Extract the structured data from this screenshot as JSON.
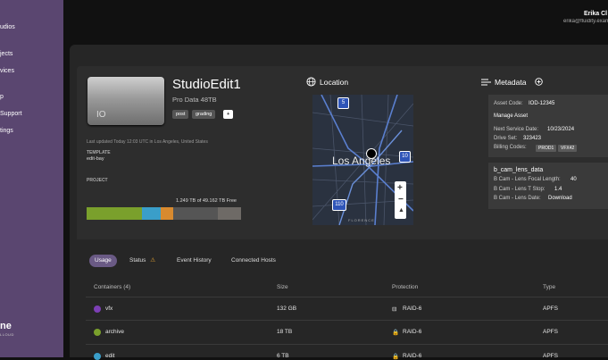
{
  "sidebar": {
    "items": [
      {
        "label": "udios"
      },
      {
        "label": "jects"
      },
      {
        "label": "vices"
      },
      {
        "label": "p"
      },
      {
        "label": "Support"
      },
      {
        "label": "tings"
      }
    ],
    "brand": {
      "name": "ne",
      "sub": "LLOUD"
    }
  },
  "user": {
    "name": "Erika Cl",
    "email": "erika@fluidity.examp"
  },
  "asset": {
    "title": "StudioEdit1",
    "subtitle": "Pro Data 48TB",
    "device_mark": "IO",
    "tags": [
      "post",
      "grading",
      "+"
    ],
    "last_updated": "Last updated Today 12:03 UTC in Los Angeles, United States",
    "template_label": "TEMPLATE",
    "template_value": "edit-bay",
    "project_label": "PROJECT",
    "usage_text": "1.249 TB of 49.162 TB Free",
    "usage_segments": [
      {
        "fraction": 0.36,
        "color": "#7aa02c"
      },
      {
        "fraction": 0.12,
        "color": "#3a9ec9"
      },
      {
        "fraction": 0.08,
        "color": "#d88a2f"
      },
      {
        "fraction": 0.29,
        "color": "#555555"
      },
      {
        "fraction": 0.15,
        "color": "#6e6a66"
      }
    ]
  },
  "location": {
    "title": "Location",
    "city": "Los Angeles",
    "highways": [
      "5",
      "10",
      "110"
    ],
    "map_footer": "FLORENCE"
  },
  "metadata": {
    "title": "Metadata",
    "card1": {
      "asset_code_label": "Asset Code:",
      "asset_code": "IOD-12345",
      "section": "Manage Asset",
      "next_service_label": "Next Service Date:",
      "next_service": "10/23/2024",
      "drive_set_label": "Drive Set:",
      "drive_set": "323423",
      "billing_label": "Billing Codes:",
      "billing_codes": [
        "PROD1",
        "VFX42"
      ]
    },
    "card2": {
      "title": "b_cam_lens_data",
      "focal_label": "B Cam - Lens Focal Length:",
      "focal": "40",
      "tstop_label": "B Cam - Lens T Stop:",
      "tstop": "1.4",
      "date_label": "B Cam - Lens Date:",
      "date": "Download"
    }
  },
  "tabs": [
    {
      "label": "Usage",
      "active": true
    },
    {
      "label": "Status",
      "warning": "⚠"
    },
    {
      "label": "Event History"
    },
    {
      "label": "Connected Hosts"
    }
  ],
  "table": {
    "headers": [
      "Containers (4)",
      "Size",
      "Protection",
      "Type"
    ],
    "rows": [
      {
        "name": "vfx",
        "size": "132 GB",
        "protection": "RAID-6",
        "type": "APFS",
        "dot": "#7c3fb5"
      },
      {
        "name": "archive",
        "size": "18 TB",
        "protection": "RAID-6",
        "type": "APFS",
        "dot": "#7aa02c"
      },
      {
        "name": "edit",
        "size": "6 TB",
        "protection": "RAID-6",
        "type": "APFS",
        "dot": "#3a9ec9"
      }
    ]
  }
}
